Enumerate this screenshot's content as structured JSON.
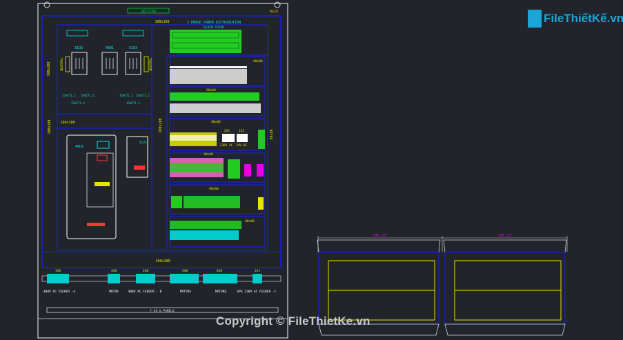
{
  "drawing": {
    "title_top": "SECTION",
    "rev_label": "W&20",
    "dim_top": "100x100",
    "dim_left_upper": "100x100",
    "dim_left_mid": "100x100",
    "dim_mid": "100x100",
    "dim_bottom": "100x100",
    "distribution_title": "3 PHASE POWER DISTRIBUTION",
    "busbar_label": "BLOCK COVER",
    "breakers": [
      "31Q3",
      "40Q1",
      "51Q3"
    ],
    "neutral_left": "NEUTRAL",
    "neutral_right": "NEUTRAL",
    "ct_labels": [
      "51HCT1.1",
      "51HCT1.2",
      "51HCT1.3",
      "41HCT1.1",
      "41HCT1.2",
      "41HCT1.3"
    ],
    "vfd_label": "40U1",
    "vfd2_label": "51U1",
    "trunk_labels": [
      "60x60",
      "60x60",
      "60x60",
      "40x60",
      "60x60",
      "60x60"
    ],
    "trunk_right_vertical": "80x80",
    "psu_labels": [
      "2X1",
      "1X2"
    ],
    "psu_voltages": [
      "230V AC",
      "24V DC"
    ],
    "feeder_tags": [
      "1X0",
      "4X0",
      "2X0",
      "5X0",
      "6X0",
      "1X1"
    ],
    "feeders": [
      "400V AC FEEDER -A",
      "MOTOR",
      "400V AC FEEDER - B",
      "MOTORS",
      "MOTORS",
      "UPS 230V AC FEEDER -C"
    ],
    "footer_label": "F-28 & PANELS",
    "side_dims": [
      "796.25",
      "796.23"
    ]
  },
  "watermark": "Copyright © FileThietKe.vn",
  "logo_text": "FileThiếtKế.vn",
  "colors": {
    "bg": "#21252b",
    "frame": "#ffffff",
    "blue": "#1a1aff",
    "yellow": "#e6e600",
    "green": "#00cc33",
    "cyan": "#00e6e6",
    "magenta": "#e600e6"
  }
}
